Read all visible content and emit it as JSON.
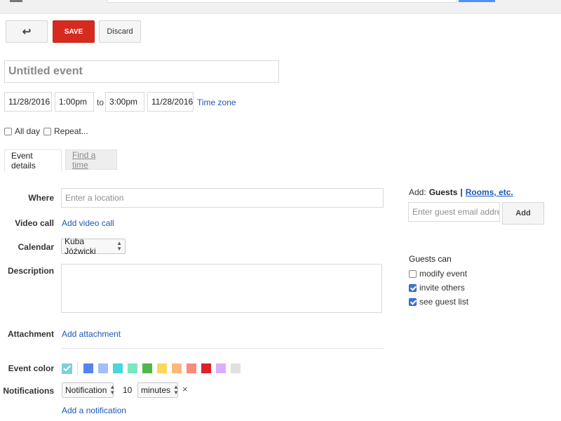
{
  "toolbar": {
    "back_icon": "arrow-back-icon",
    "back_glyph": "↩",
    "save_label": "SAVE",
    "discard_label": "Discard"
  },
  "event": {
    "title_placeholder": "Untitled event",
    "start_date": "11/28/2016",
    "start_time": "1:00pm",
    "to_label": "to",
    "end_time": "3:00pm",
    "end_date": "11/28/2016",
    "timezone_label": "Time zone",
    "all_day_label": "All day",
    "all_day_checked": false,
    "repeat_label": "Repeat...",
    "repeat_checked": false
  },
  "tabs": [
    {
      "label": "Event details",
      "active": true
    },
    {
      "label": "Find a time",
      "active": false
    }
  ],
  "details": {
    "where_label": "Where",
    "where_placeholder": "Enter a location",
    "video_label": "Video call",
    "video_link": "Add video call",
    "calendar_label": "Calendar",
    "calendar_value": "Kuba Jóźwicki",
    "description_label": "Description",
    "attachment_label": "Attachment",
    "attachment_link": "Add attachment",
    "color_label": "Event color",
    "colors": [
      "#7ed0d8",
      "#5484ed",
      "#a4bdfc",
      "#46d6db",
      "#7ae7bf",
      "#51b749",
      "#fbd75b",
      "#ffb878",
      "#ff887c",
      "#dc2127",
      "#dbadff",
      "#e1e1e1"
    ],
    "selected_color": "#7ed0d8",
    "notifications_label": "Notifications",
    "notification_type": "Notification",
    "notification_value": "10",
    "notification_unit": "minutes",
    "notification_remove_glyph": "×",
    "add_notification_link": "Add a notification"
  },
  "guests": {
    "add_label": "Add:",
    "guests_tab": "Guests",
    "separator": "|",
    "rooms_tab": "Rooms, etc.",
    "email_placeholder": "Enter guest email addres",
    "add_button": "Add",
    "guests_can_label": "Guests can",
    "permissions": [
      {
        "label": "modify event",
        "checked": false
      },
      {
        "label": "invite others",
        "checked": true
      },
      {
        "label": "see guest list",
        "checked": true
      }
    ]
  }
}
